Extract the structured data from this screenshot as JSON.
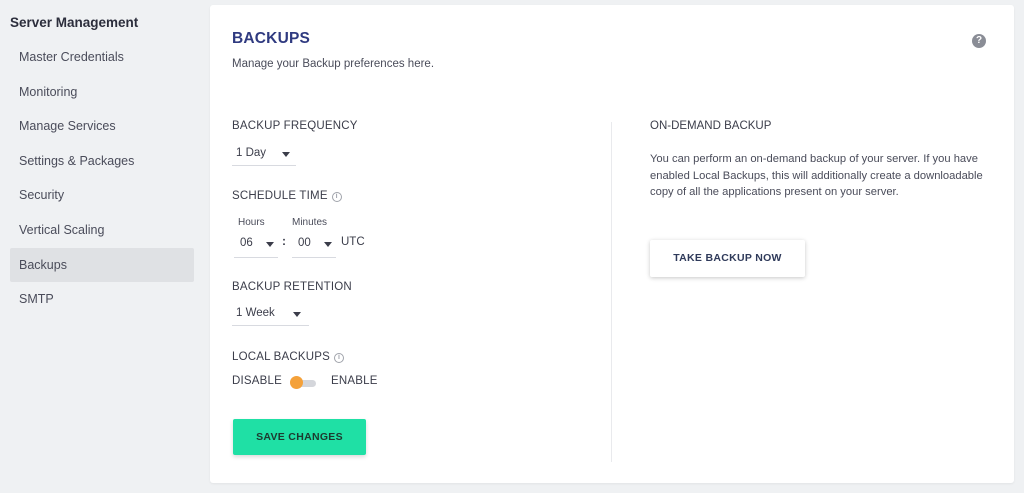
{
  "sidebar": {
    "title": "Server Management",
    "items": [
      {
        "label": "Master Credentials"
      },
      {
        "label": "Monitoring"
      },
      {
        "label": "Manage Services"
      },
      {
        "label": "Settings & Packages"
      },
      {
        "label": "Security"
      },
      {
        "label": "Vertical Scaling"
      },
      {
        "label": "Backups",
        "active": true
      },
      {
        "label": "SMTP"
      }
    ]
  },
  "card": {
    "title": "BACKUPS",
    "subtitle": "Manage your Backup preferences here.",
    "help_icon": "question-circle-icon",
    "help_glyph": "?"
  },
  "backup_frequency": {
    "label": "BACKUP FREQUENCY",
    "value": "1 Day"
  },
  "schedule_time": {
    "label": "SCHEDULE TIME",
    "info_icon": "info-icon",
    "hours_label": "Hours",
    "minutes_label": "Minutes",
    "hours_value": "06",
    "minutes_value": "00",
    "separator": ":",
    "timezone": "UTC"
  },
  "backup_retention": {
    "label": "BACKUP RETENTION",
    "value": "1 Week"
  },
  "local_backups": {
    "label": "LOCAL BACKUPS",
    "info_icon": "info-icon",
    "off_label": "DISABLE",
    "on_label": "ENABLE",
    "enabled": false
  },
  "save_button": {
    "label": "SAVE CHANGES"
  },
  "on_demand": {
    "title": "ON-DEMAND BACKUP",
    "description": "You can perform an on-demand backup of your server. If you have enabled Local Backups, this will additionally create a downloadable copy of all the applications present on your server.",
    "button_label": "TAKE BACKUP NOW"
  },
  "colors": {
    "accent_title": "#2f3a80",
    "save_button": "#1fe0a5",
    "toggle_knob": "#f4a13a",
    "sidebar_active_bg": "#dfe1e4"
  }
}
